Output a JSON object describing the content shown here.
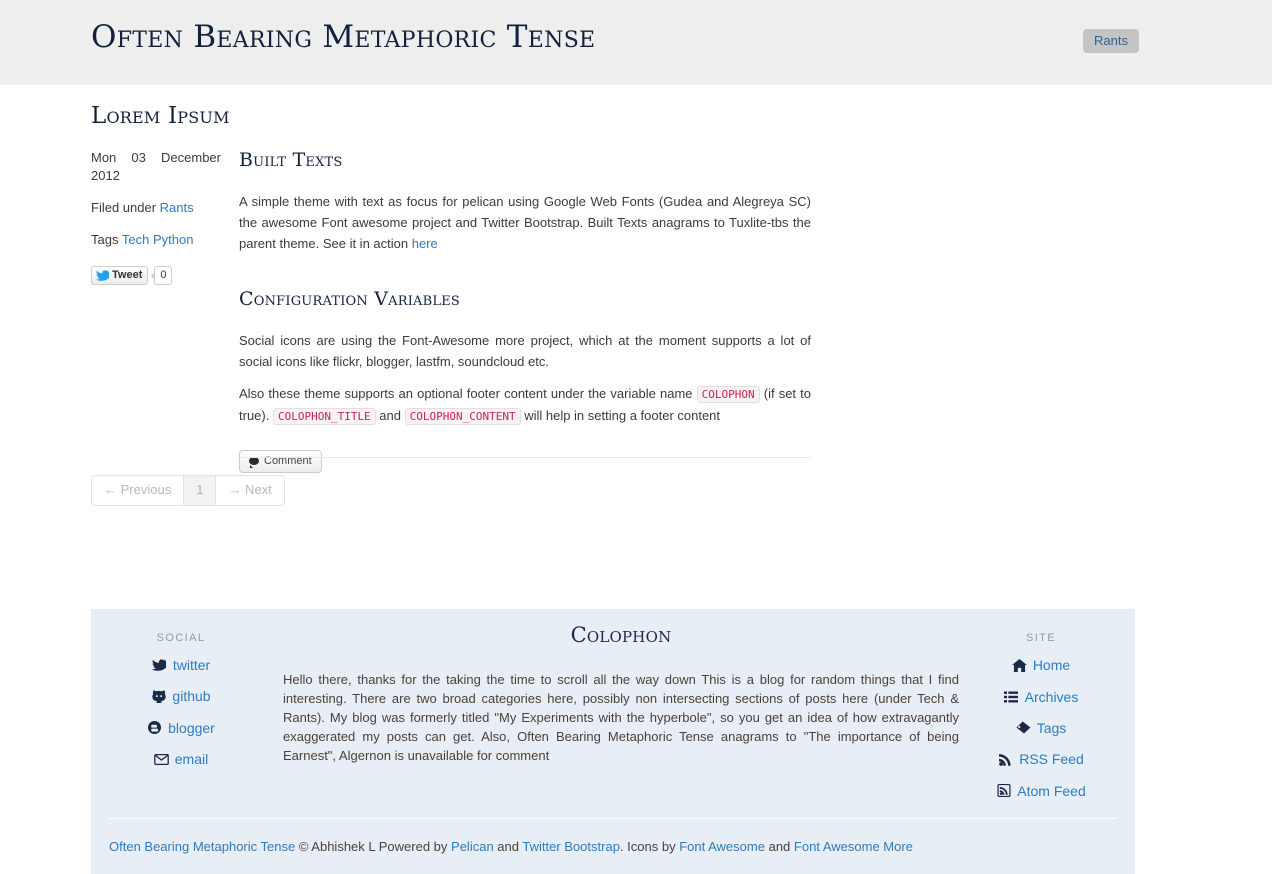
{
  "header": {
    "site_title": "Often Bearing Metaphoric Tense",
    "nav": [
      {
        "label": "Rants",
        "name": "nav-button-rants"
      }
    ]
  },
  "article": {
    "title": "Lorem Ipsum",
    "meta": {
      "date": "Mon 03 December 2012",
      "filed_label": "Filed under",
      "category": "Rants",
      "tags_label": "Tags",
      "tags": [
        "Tech",
        "Python"
      ],
      "tweet_label": "Tweet",
      "tweet_count": "0"
    },
    "sections": [
      {
        "heading": "Built Texts",
        "paragraphs": [
          {
            "pre": "A simple theme with text as focus for pelican using Google Web Fonts (Gudea and Alegreya SC) the awesome Font awesome project and Twitter Bootstrap. Built Texts anagrams to Tuxlite-tbs the parent theme. See it in action ",
            "link": "here",
            "post": ""
          }
        ]
      },
      {
        "heading": "Configuration Variables",
        "paragraphs": [
          {
            "pre": "Social icons are using the Font-Awesome more project, which at the moment supports a lot of social icons like flickr, blogger, lastfm, soundcloud etc.",
            "link": "",
            "post": ""
          }
        ],
        "paragraph2": {
          "part1": "Also these theme supports an optional footer content under the variable name ",
          "code1": "COLOPHON",
          "part2": " (if set to true). ",
          "code2": "COLOPHON_TITLE",
          "part3": " and ",
          "code3": "COLOPHON_CONTENT",
          "part4": " will help in setting a footer content"
        }
      }
    ],
    "comment_label": "Comment"
  },
  "pagination": {
    "previous": "← Previous",
    "current_page": "1",
    "next": "→ Next"
  },
  "footer": {
    "social": {
      "heading": "SOCIAL",
      "items": [
        {
          "label": "twitter",
          "icon": "twitter-icon",
          "glyph": "🐦"
        },
        {
          "label": "github",
          "icon": "github-icon",
          "glyph": "●"
        },
        {
          "label": "blogger",
          "icon": "blogger-icon",
          "glyph": "B"
        },
        {
          "label": "email",
          "icon": "envelope-icon",
          "glyph": "✉"
        }
      ]
    },
    "site": {
      "heading": "SITE",
      "items": [
        {
          "label": "Home",
          "icon": "home-icon",
          "glyph": "⌂"
        },
        {
          "label": "Archives",
          "icon": "list-icon",
          "glyph": "≣"
        },
        {
          "label": "Tags",
          "icon": "tag-icon",
          "glyph": "⚑"
        },
        {
          "label": "RSS Feed",
          "icon": "rss-icon",
          "glyph": "◢"
        },
        {
          "label": "Atom Feed",
          "icon": "atom-feed-icon",
          "glyph": "◢"
        }
      ]
    },
    "colophon": {
      "title": "Colophon",
      "text": "Hello there, thanks for the taking the time to scroll all the way down This is a blog for random things that I find interesting. There are two broad categories here, possibly non intersecting sections of posts here (under Tech & Rants). My blog was formerly titled \"My Experiments with the hyperbole\", so you get an idea of how extravagantly exaggerated my posts can get. Also, Often Bearing Metaphoric Tense anagrams to \"The importance of being Earnest\", Algernon is unavailable for comment"
    },
    "credits": {
      "site_link": "Often Bearing Metaphoric Tense",
      "copyright": "© Abhishek L Powered by",
      "pelican": "Pelican",
      "and1": "and",
      "bootstrap": "Twitter Bootstrap",
      "icons_by": ". Icons by",
      "fa": "Font Awesome",
      "and2": "and",
      "fam": "Font Awesome More"
    }
  },
  "colors": {
    "header_bg": "#eeeeee",
    "link": "#2e7bbd",
    "footer_bg": "#e8eef6",
    "code": "#c7254e",
    "heading": "#12203c"
  }
}
